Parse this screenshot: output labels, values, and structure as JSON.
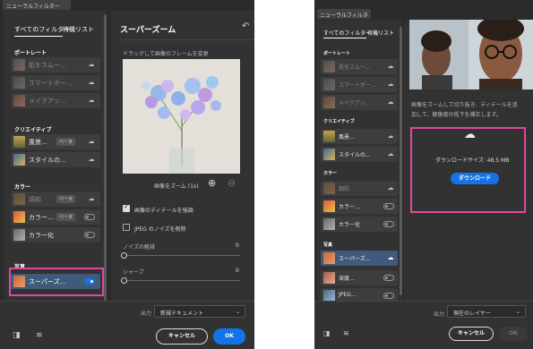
{
  "left": {
    "window_title": "ニューラルフィルター",
    "tab_all": "すべてのフィルター",
    "tab_wait": "待機リスト",
    "sections": {
      "portrait": "ポートレート",
      "creative": "クリエイティブ",
      "color": "カラー",
      "photo": "写真"
    },
    "items": {
      "skin": "肌をスムー…",
      "smart": "スマートポー…",
      "makeup": "メイクアッ…",
      "landscape": "風景…",
      "style": "スタイルの…",
      "harmonize": "調和",
      "colorxfer": "カラー…",
      "colorize": "カラー化",
      "superzoom": "スーパーズ…"
    },
    "badges": {
      "beta1": "ベータ",
      "beta2": "ベータ",
      "beta3": "ベータ"
    },
    "detail": {
      "title": "スーパーズーム",
      "drag_hint": "ドラッグして画像のフレームを変更",
      "zoom_label": "画像をズーム (1x)",
      "enhance_detail": "画像のディテールを強調",
      "jpeg_noise": "JPEG のノイズを削除",
      "noise_label": "ノイズの軽減",
      "noise_value": "0",
      "sharpen_label": "シャープ",
      "sharpen_value": "0"
    },
    "output_label": "出力",
    "output_value": "新規ドキュメント",
    "cancel": "キャンセル",
    "ok": "OK"
  },
  "right": {
    "window_title": "ニューラルフィルター",
    "tab_all": "すべてのフィルター",
    "tab_wait": "待機リスト",
    "sections": {
      "portrait": "ポートレート",
      "creative": "クリエイティブ",
      "color": "カラー",
      "photo": "写真"
    },
    "items": {
      "skin": "肌をスムー…",
      "smart": "スマートポー…",
      "makeup": "メイクアッ…",
      "landscape": "風景…",
      "style": "スタイルの…",
      "harmonize": "調和",
      "colorxfer": "カラー…",
      "colorize": "カラー化",
      "superzoom": "スーパーズ…",
      "depth": "深度…",
      "jpeg": "JPEG…"
    },
    "desc_line1": "画像をズームして切り抜き、ディテールを追",
    "desc_line2": "加して、解像度の低下を補正します。",
    "download_size": "ダウンロードサイズ: 48.5 MB",
    "download_btn": "ダウンロード",
    "output_label": "出力",
    "output_value": "現在のレイヤー",
    "cancel": "キャンセル",
    "ok": "OK"
  },
  "colors": {
    "panel": "#323232",
    "accent_blue": "#1473e6",
    "highlight_pink": "#e0479e",
    "selected_item": "#3f5a7a"
  }
}
